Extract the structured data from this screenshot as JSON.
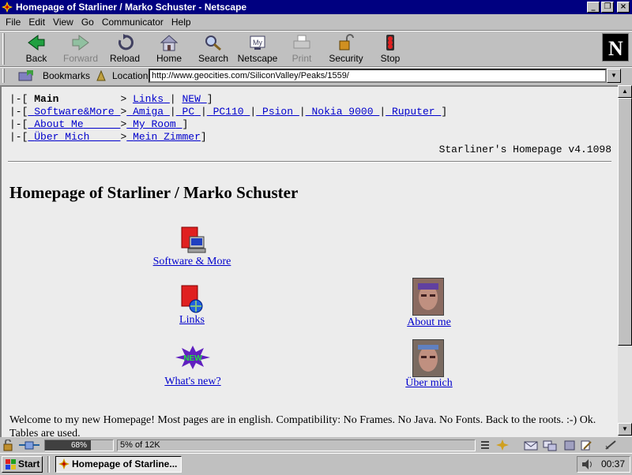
{
  "window": {
    "title": "Homepage of Starliner / Marko Schuster - Netscape"
  },
  "menu": [
    "File",
    "Edit",
    "View",
    "Go",
    "Communicator",
    "Help"
  ],
  "toolbar": {
    "back": "Back",
    "forward": "Forward",
    "reload": "Reload",
    "home": "Home",
    "search": "Search",
    "netscape": "Netscape",
    "print": "Print",
    "security": "Security",
    "stop": "Stop"
  },
  "location": {
    "bookmarks": "Bookmarks",
    "label": "Location:",
    "url": "http://www.geocities.com/SiliconValley/Peaks/1559/"
  },
  "nav": {
    "main": "Main",
    "links": "Links",
    "new": "NEW",
    "software": "Software&More",
    "amiga": "Amiga",
    "pc": "PC",
    "pc110": "PC110",
    "psion": "Psion",
    "nokia": "Nokia 9000",
    "ruputer": "Ruputer",
    "about": "About Me",
    "room": "My Room",
    "ueber": "Über Mich",
    "zimmer": "Mein Zimmer"
  },
  "version": "Starliner's Homepage v4.1098",
  "heading": "Homepage of Starliner / Marko Schuster",
  "items": {
    "software": "Software & More",
    "links": "Links",
    "whatsnew": "What's new?",
    "aboutme": "About me",
    "uebermich": "Über mich",
    "new_badge": "NEW"
  },
  "welcome": "Welcome to my new Homepage! Most pages are in english. Compatibility: No Frames. No Java. No Fonts. Back to the roots. :-) Ok. Tables are used.",
  "status": {
    "progress_text": "68%",
    "progress": 0.68,
    "text": "5% of 12K"
  },
  "taskbar": {
    "start": "Start",
    "task": "Homepage of Starline...",
    "clock": "00:37"
  }
}
